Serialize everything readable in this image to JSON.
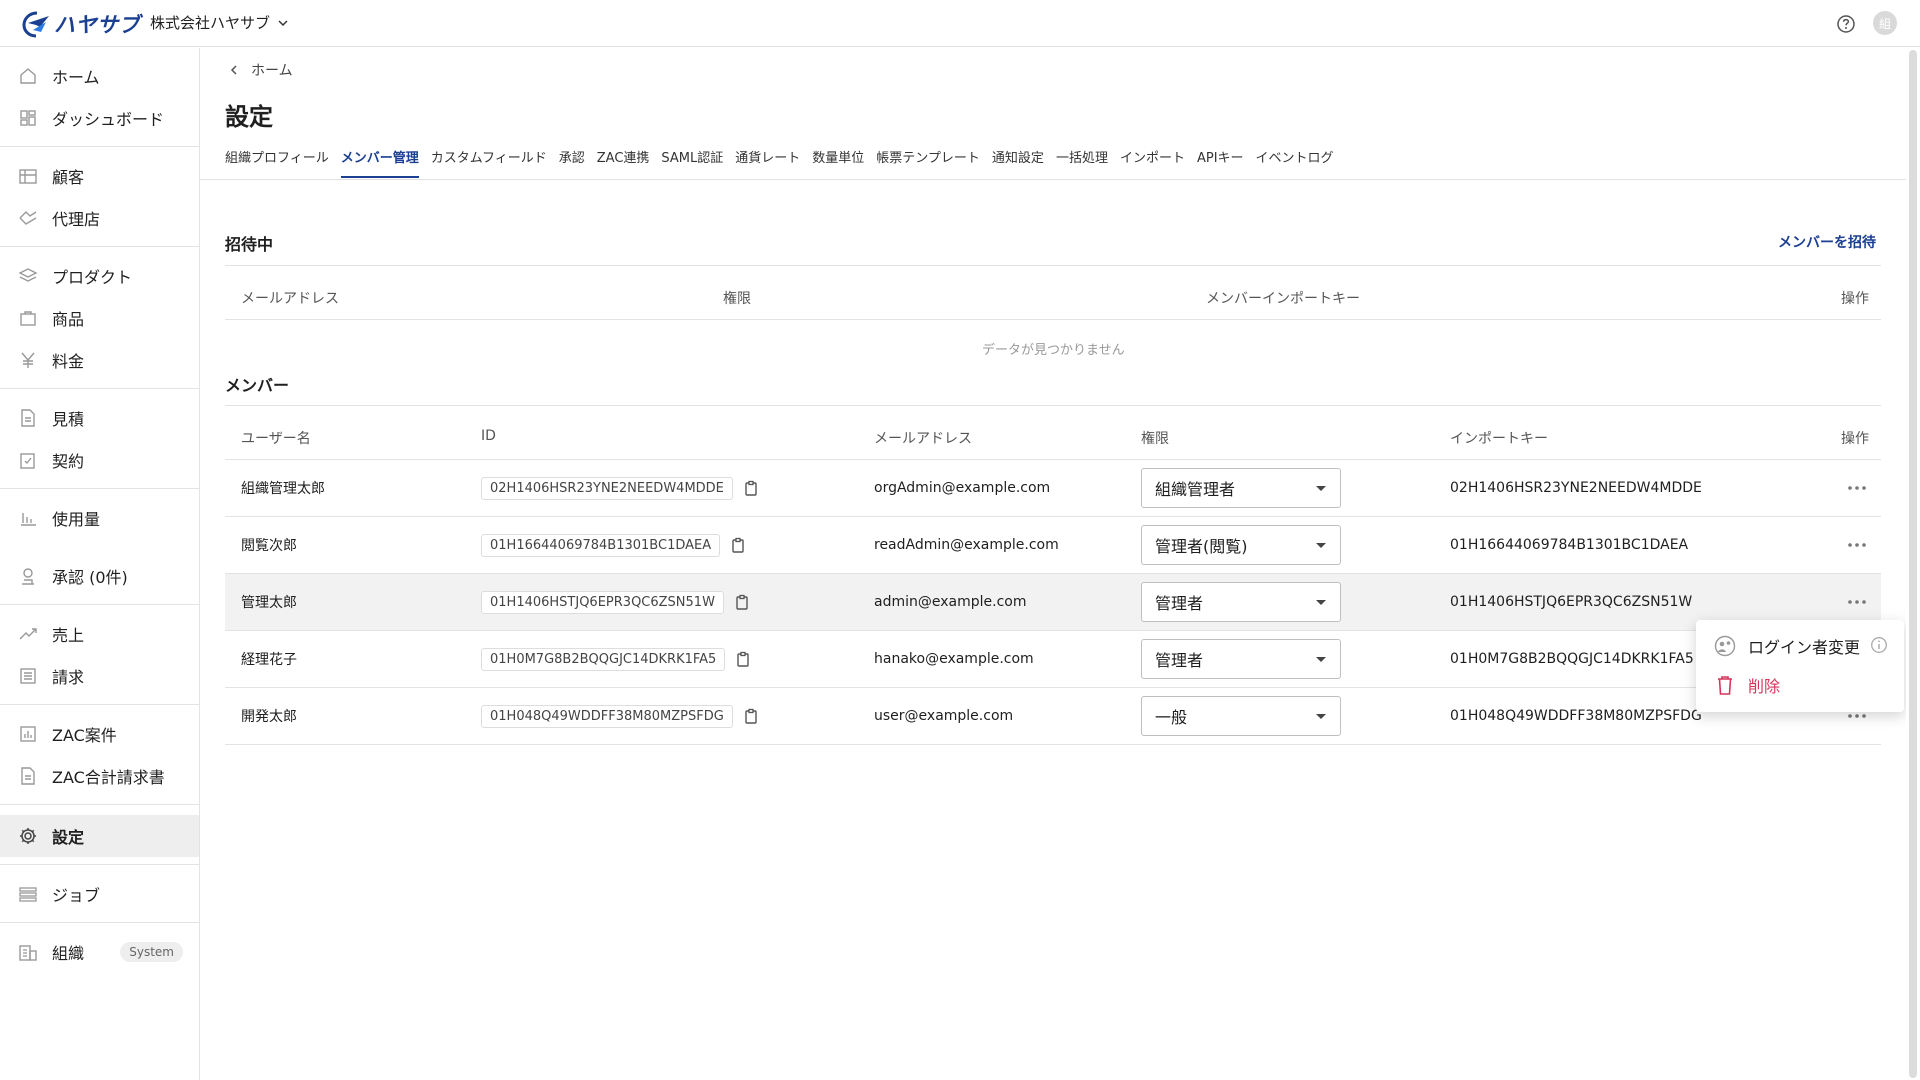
{
  "header": {
    "logo_text": "ハヤサブ",
    "org_name": "株式会社ハヤサブ",
    "avatar_initial": "組"
  },
  "sidebar": {
    "items": [
      {
        "label": "ホーム",
        "icon": "home-icon"
      },
      {
        "label": "ダッシュボード",
        "icon": "dashboard-icon"
      },
      {
        "label": "顧客",
        "icon": "customer-icon"
      },
      {
        "label": "代理店",
        "icon": "agency-icon"
      },
      {
        "label": "プロダクト",
        "icon": "product-icon"
      },
      {
        "label": "商品",
        "icon": "goods-icon"
      },
      {
        "label": "料金",
        "icon": "yen-icon"
      },
      {
        "label": "見積",
        "icon": "quote-icon"
      },
      {
        "label": "契約",
        "icon": "contract-icon"
      },
      {
        "label": "使用量",
        "icon": "usage-icon"
      },
      {
        "label": "承認 (0件)",
        "icon": "approval-icon"
      },
      {
        "label": "売上",
        "icon": "sales-icon"
      },
      {
        "label": "請求",
        "icon": "invoice-icon"
      },
      {
        "label": "ZAC案件",
        "icon": "zac-project-icon"
      },
      {
        "label": "ZAC合計請求書",
        "icon": "zac-invoice-icon"
      },
      {
        "label": "設定",
        "icon": "gear-icon",
        "active": true
      },
      {
        "label": "ジョブ",
        "icon": "job-icon"
      },
      {
        "label": "組織",
        "icon": "organization-icon",
        "badge": "System"
      }
    ]
  },
  "breadcrumb": {
    "back_label": "ホーム"
  },
  "page": {
    "title": "設定"
  },
  "tabs": [
    {
      "label": "組織プロフィール"
    },
    {
      "label": "メンバー管理",
      "active": true
    },
    {
      "label": "カスタムフィールド"
    },
    {
      "label": "承認"
    },
    {
      "label": "ZAC連携"
    },
    {
      "label": "SAML認証"
    },
    {
      "label": "通貨レート"
    },
    {
      "label": "数量単位"
    },
    {
      "label": "帳票テンプレート"
    },
    {
      "label": "通知設定"
    },
    {
      "label": "一括処理"
    },
    {
      "label": "インポート"
    },
    {
      "label": "APIキー"
    },
    {
      "label": "イベントログ"
    }
  ],
  "invites": {
    "title": "招待中",
    "invite_button": "メンバーを招待",
    "columns": [
      "メールアドレス",
      "権限",
      "メンバーインポートキー",
      "操作"
    ],
    "empty_message": "データが見つかりません"
  },
  "members": {
    "title": "メンバー",
    "columns": [
      "ユーザー名",
      "ID",
      "メールアドレス",
      "権限",
      "インポートキー",
      "操作"
    ],
    "rows": [
      {
        "name": "組織管理太郎",
        "id": "02H1406HSR23YNE2NEEDW4MDDE",
        "email": "orgAdmin@example.com",
        "role": "組織管理者",
        "import_key": "02H1406HSR23YNE2NEEDW4MDDE"
      },
      {
        "name": "閲覧次郎",
        "id": "01H16644069784B1301BC1DAEA",
        "email": "readAdmin@example.com",
        "role": "管理者(閲覧)",
        "import_key": "01H16644069784B1301BC1DAEA"
      },
      {
        "name": "管理太郎",
        "id": "01H1406HSTJQ6EPR3QC6ZSN51W",
        "email": "admin@example.com",
        "role": "管理者",
        "import_key": "01H1406HSTJQ6EPR3QC6ZSN51W"
      },
      {
        "name": "経理花子",
        "id": "01H0M7G8B2BQQGJC14DKRK1FA5",
        "email": "hanako@example.com",
        "role": "管理者",
        "import_key": "01H0M7G8B2BQQGJC14DKRK1FA5"
      },
      {
        "name": "開発太郎",
        "id": "01H048Q49WDDFF38M80MZPSFDG",
        "email": "user@example.com",
        "role": "一般",
        "import_key": "01H048Q49WDDFF38M80MZPSFDG"
      }
    ]
  },
  "row_menu": {
    "login_switch": "ログイン者変更",
    "delete": "削除"
  },
  "colors": {
    "brand": "#1b3f91",
    "danger": "#d6355c"
  }
}
